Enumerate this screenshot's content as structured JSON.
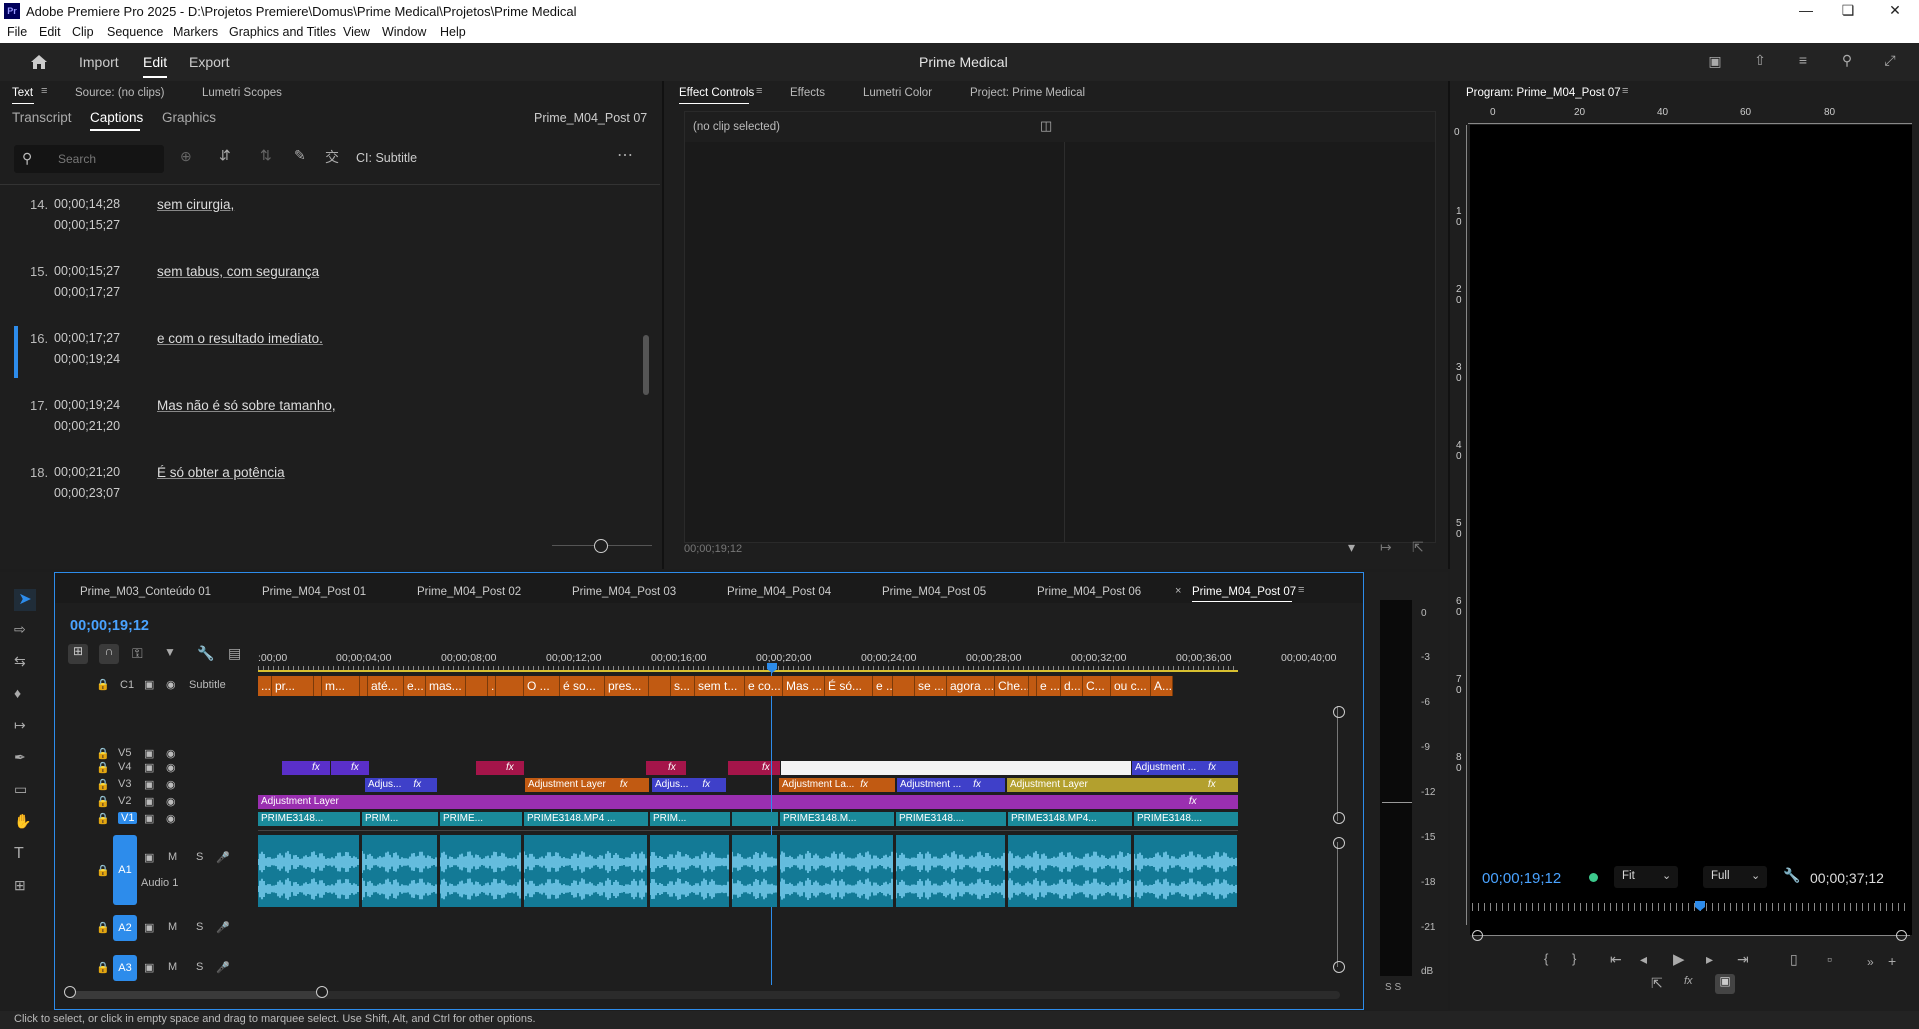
{
  "window": {
    "title": "Adobe Premiere Pro 2025 - D:\\Projetos Premiere\\Domus\\Prime Medical\\Projetos\\Prime Medical",
    "app_icon": "Pr"
  },
  "menu": [
    "File",
    "Edit",
    "Clip",
    "Sequence",
    "Markers",
    "Graphics and Titles",
    "View",
    "Window",
    "Help"
  ],
  "header": {
    "import": "Import",
    "edit": "Edit",
    "export": "Export",
    "project_name": "Prime Medical"
  },
  "text_panel": {
    "tabs": [
      "Text",
      "Source: (no clips)",
      "Lumetri Scopes"
    ],
    "subtabs": [
      "Transcript",
      "Captions",
      "Graphics"
    ],
    "sequence": "Prime_M04_Post 07",
    "search_placeholder": "Search",
    "track_label": "CI: Subtitle",
    "captions": [
      {
        "num": "14.",
        "in": "00;00;14;28",
        "out": "00;00;15;27",
        "text": "sem cirurgia,"
      },
      {
        "num": "15.",
        "in": "00;00;15;27",
        "out": "00;00;17;27",
        "text": "sem tabus, com segurança"
      },
      {
        "num": "16.",
        "in": "00;00;17;27",
        "out": "00;00;19;24",
        "text": "e com o resultado imediato."
      },
      {
        "num": "17.",
        "in": "00;00;19;24",
        "out": "00;00;21;20",
        "text": "Mas não é só sobre tamanho,"
      },
      {
        "num": "18.",
        "in": "00;00;21;20",
        "out": "00;00;23;07",
        "text": "É só obter a potência"
      }
    ]
  },
  "effect_panel": {
    "tabs": [
      "Effect Controls",
      "Effects",
      "Lumetri Color",
      "Project: Prime Medical"
    ],
    "no_clip": "(no clip selected)",
    "timecode": "00;00;19;12"
  },
  "program": {
    "title": "Program: Prime_M04_Post 07",
    "ruler": [
      "0",
      "20",
      "40",
      "60",
      "80"
    ],
    "vruler": [
      "0",
      "1\n0",
      "2\n0",
      "3\n0",
      "4\n0",
      "5\n0",
      "6\n0",
      "7\n0",
      "8\n0"
    ],
    "timecode": "00;00;19;12",
    "fit": "Fit",
    "full": "Full",
    "duration": "00;00;37;12"
  },
  "timeline": {
    "tabs": [
      "Prime_M03_Conteúdo 01",
      "Prime_M04_Post 01",
      "Prime_M04_Post 02",
      "Prime_M04_Post 03",
      "Prime_M04_Post 04",
      "Prime_M04_Post 05",
      "Prime_M04_Post 06",
      "Prime_M04_Post 07"
    ],
    "timecode": "00;00;19;12",
    "ticks": [
      ":00;00",
      "00;00;04;00",
      "00;00;08;00",
      "00;00;12;00",
      "00;00;16;00",
      "00;00;20;00",
      "00;00;24;00",
      "00;00;28;00",
      "00;00;32;00",
      "00;00;36;00",
      "00;00;40;00"
    ],
    "caption_track": "Subtitle",
    "captions": [
      "...",
      "pr...",
      "",
      "m...",
      "",
      "até...",
      "e...",
      "mas...",
      "",
      "...",
      "",
      "O ...",
      "é so...",
      "pres...",
      "",
      "s...",
      "sem t...",
      "e co...",
      "Mas ...",
      "É só...",
      "e ...",
      "",
      "se ...",
      "agora ...",
      "Che...",
      "",
      "e ...",
      "d...",
      "C...",
      "ou c...",
      "A..."
    ],
    "tracks": {
      "v": [
        "V5",
        "V4",
        "V3",
        "V2",
        "V1"
      ],
      "a": [
        "A1",
        "A2",
        "A3"
      ],
      "audio1": "Audio 1",
      "c1": "C1"
    },
    "clips": {
      "adj": "Adjustment Layer",
      "adj_short": "Adjus...",
      "adj_la": "Adjustment La...",
      "adj_dots": "Adjustment ...",
      "prime": [
        "PRIME3148...",
        "PRIM...",
        "PRIME...",
        "PRIME3148.MP4 ...",
        "PRIM...",
        "",
        "PRIME3148.M...",
        "PRIME3148....",
        "PRIME3148.MP4...",
        "PRIME3148...."
      ],
      "fx": "fx"
    },
    "meter": [
      "0",
      "-3",
      "-6",
      "-9",
      "-12",
      "-15",
      "-18",
      "-21",
      "dB"
    ],
    "meter_ss": "S  S"
  },
  "status": "Click to select, or click in empty space and drag to marquee select. Use Shift, Alt, and Ctrl for other options."
}
